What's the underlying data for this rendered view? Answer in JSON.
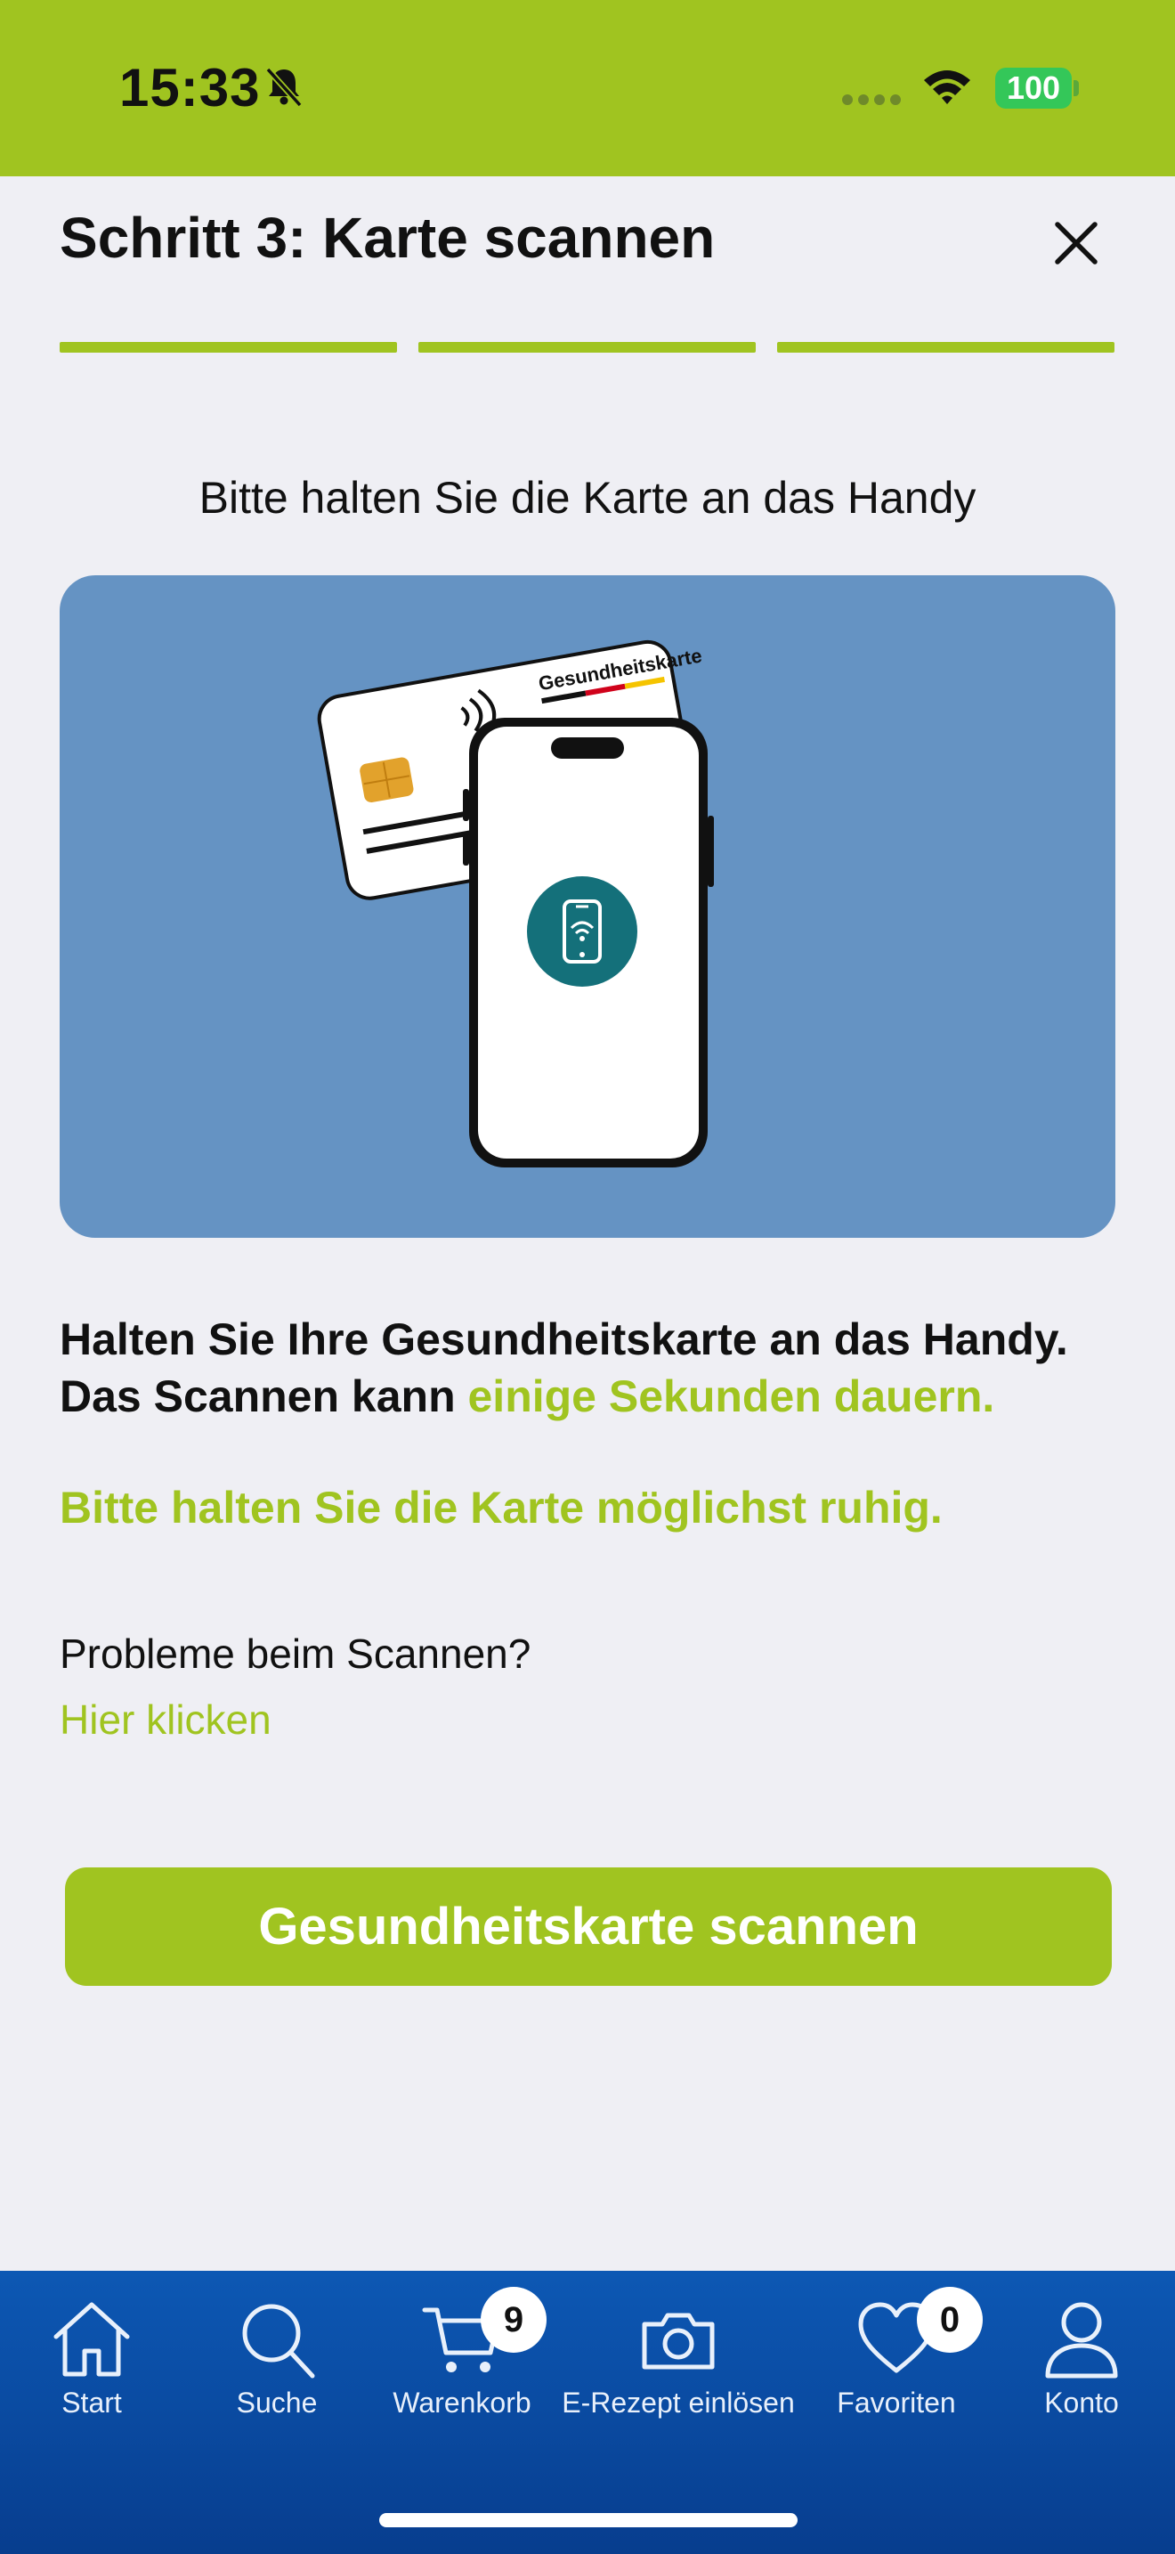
{
  "status_bar": {
    "time": "15:33",
    "battery": "100",
    "icons": [
      "bell-slash-icon",
      "signal-icon",
      "wifi-icon",
      "battery-icon"
    ]
  },
  "header": {
    "title": "Schritt 3: Karte scannen",
    "close_icon": "close-icon",
    "steps_completed": 3,
    "steps_total": 3
  },
  "main": {
    "heading": "Bitte halten Sie die Karte an das Handy",
    "illustration": {
      "card_label": "Gesundheitskarte",
      "icons": [
        "health-card-icon",
        "phone-icon",
        "nfc-icon"
      ]
    },
    "body_line1": "Halten Sie Ihre Gesundheitskarte an das Handy.",
    "body_line2_prefix": "Das Scannen kann ",
    "body_line2_accent": "einige Sekunden dauern.",
    "hint": "Bitte halten Sie die Karte möglichst ruhig.",
    "problem_text": "Probleme beim Scannen?",
    "help_link": "Hier klicken",
    "scan_button": "Gesundheitskarte scannen"
  },
  "tab_bar": {
    "items": [
      {
        "label": "Start",
        "icon": "home-icon"
      },
      {
        "label": "Suche",
        "icon": "search-icon"
      },
      {
        "label": "Warenkorb",
        "icon": "cart-icon",
        "badge": "9"
      },
      {
        "label": "E-Rezept einlösen",
        "icon": "camera-icon"
      },
      {
        "label": "Favoriten",
        "icon": "heart-icon",
        "badge": "0"
      },
      {
        "label": "Konto",
        "icon": "user-icon"
      }
    ]
  },
  "colors": {
    "accent": "#a0c420",
    "background": "#efeff4",
    "illustration_bg": "#6593c3",
    "tab_bar": "#0d58b4"
  }
}
